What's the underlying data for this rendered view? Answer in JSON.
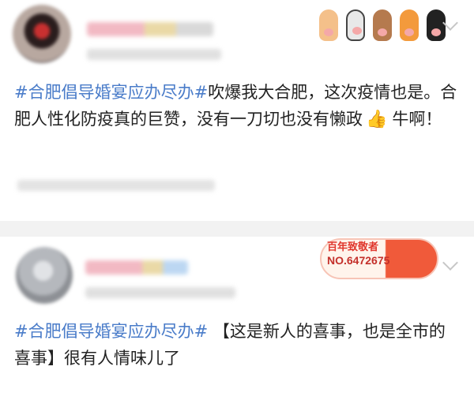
{
  "post1": {
    "text_topic": "#合肥倡导婚宴应办尽办#",
    "text_body": "吹爆我大合肥，这次疫情也是。合肥人性化防疫真的巨赞，没有一刀切也没有懒政",
    "thumb_glyph": "👍",
    "text_tail": "牛啊！"
  },
  "post2": {
    "text_topic": "#合肥倡导婚宴应办尽办#",
    "text_body": " 【这是新人的喜事，也是全市的喜事】很有人情味儿了",
    "badge_title": "百年致敬者",
    "badge_number": "NO.6472675"
  },
  "colors": {
    "topic": "#4a7cc9",
    "badge": "#e0362c",
    "divider": "#f2f2f2"
  },
  "icons": [
    "avatar",
    "cat-paw-icon",
    "chevron-down-icon",
    "thumbs-up-icon",
    "commemorative-badge-icon"
  ]
}
